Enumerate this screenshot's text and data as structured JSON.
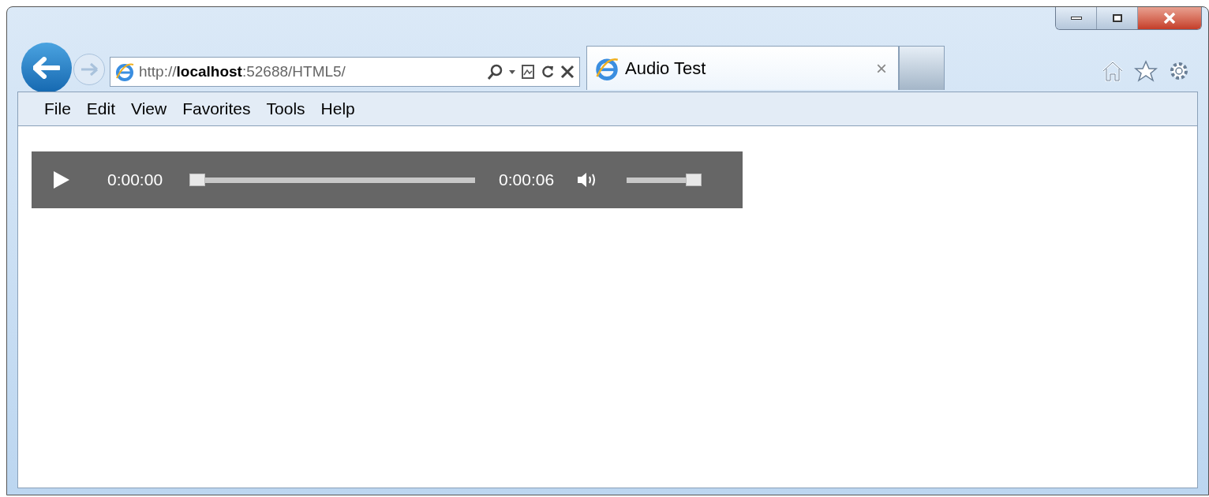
{
  "address_bar": {
    "url": "http://**localhost**:52688/HTML5/"
  },
  "tabs": [
    {
      "label": "Audio Test",
      "selected": true,
      "close": "×"
    }
  ],
  "menu_bar": [
    "File",
    "Edit",
    "View",
    "Favorites",
    "Tools",
    "Help"
  ],
  "audio_player": {
    "playing": false,
    "current_time": "0:00:00",
    "seek": {
      "level": 0
    },
    "duration": "0:00:06",
    "muted": false,
    "volume": {
      "level": 1
    }
  }
}
